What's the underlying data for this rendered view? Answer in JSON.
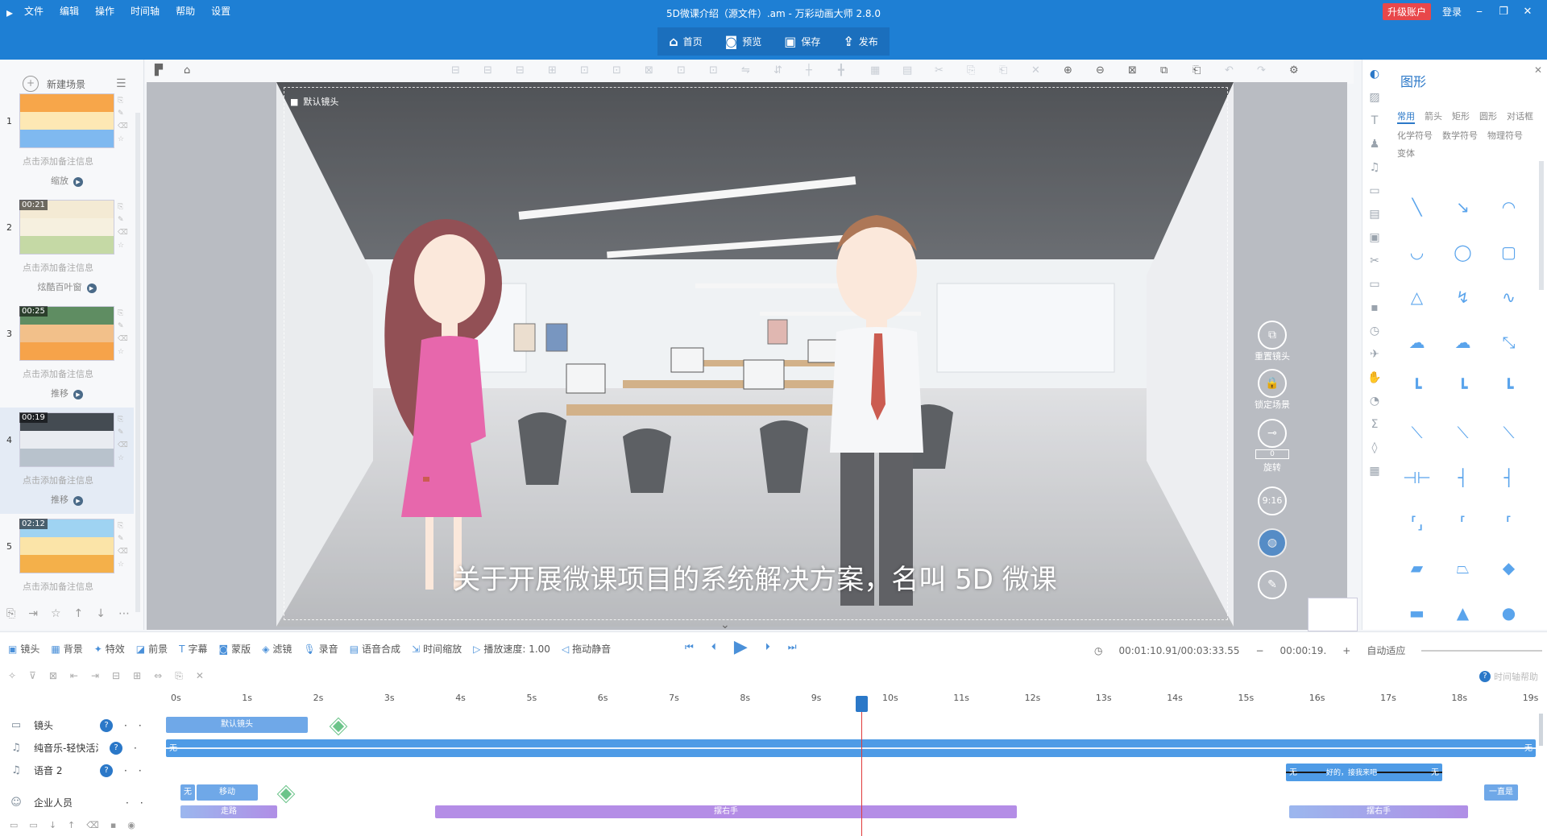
{
  "app": {
    "logo_text": "▸",
    "window_title": "5D微课介绍（源文件）.am - 万彩动画大师 2.8.0",
    "menu": [
      "文件",
      "编辑",
      "操作",
      "时间轴",
      "帮助",
      "设置"
    ],
    "upgrade_label": "升级账户",
    "login_label": "登录",
    "win_controls": [
      "⎯",
      "❐",
      "✕"
    ]
  },
  "main_toolbar": [
    {
      "icon": "home-icon",
      "glyph": "⌂",
      "label": "首页"
    },
    {
      "icon": "preview-icon",
      "glyph": "◙",
      "label": "预览"
    },
    {
      "icon": "save-icon",
      "glyph": "▣",
      "label": "保存"
    },
    {
      "icon": "publish-icon",
      "glyph": "⇪",
      "label": "发布"
    }
  ],
  "scene_panel": {
    "new_scene_label": "新建场景",
    "scenes": [
      {
        "num": "1",
        "duration": "",
        "note": "点击添加备注信息",
        "transition": "缩放",
        "thumb_colors": [
          "#f7a64a",
          "#fde8b4",
          "#7fb9f0"
        ]
      },
      {
        "num": "2",
        "duration": "00:21",
        "note": "点击添加备注信息",
        "transition": "炫酷百叶窗",
        "thumb_colors": [
          "#f4ead4",
          "#f6f0df",
          "#c5d9a5"
        ]
      },
      {
        "num": "3",
        "duration": "00:25",
        "note": "点击添加备注信息",
        "transition": "推移",
        "thumb_colors": [
          "#5f8d62",
          "#f2c08a",
          "#f6a34a"
        ]
      },
      {
        "num": "4",
        "duration": "00:19",
        "note": "点击添加备注信息",
        "transition": "推移",
        "thumb_colors": [
          "#444b52",
          "#e9ecf1",
          "#b8c2cc"
        ]
      },
      {
        "num": "5",
        "duration": "02:12",
        "note": "点击添加备注信息",
        "transition": "",
        "thumb_colors": [
          "#9fd3f2",
          "#fbe4a8",
          "#f4b04a"
        ]
      }
    ]
  },
  "stage": {
    "camera_label": "默认镜头",
    "subtitle": "关于开展微课项目的系统解决方案，名叫 5D 微课",
    "controls": [
      {
        "name": "reset-camera",
        "glyph": "⧉",
        "label": "重置镜头"
      },
      {
        "name": "lock-scene",
        "glyph": "🔒",
        "label": "锁定场景"
      },
      {
        "name": "rotate",
        "glyph": "⊸",
        "label": "旋转"
      },
      {
        "name": "ratio",
        "glyph": "9:16",
        "label": ""
      },
      {
        "name": "mask",
        "glyph": "◍",
        "label": ""
      },
      {
        "name": "pen",
        "glyph": "✎",
        "label": ""
      }
    ],
    "rotate_value": "0"
  },
  "shape_panel": {
    "title": "图形",
    "close": "✕",
    "tabs": [
      "常用",
      "箭头",
      "矩形",
      "圆形",
      "对话框",
      "化学符号",
      "数学符号",
      "物理符号",
      "变体"
    ],
    "selected_tab": "常用",
    "shapes": [
      "╲",
      "↘",
      "◠",
      "◡",
      "◯",
      "▢",
      "△",
      "↯",
      "∿",
      "☁",
      "☁",
      "⤡",
      "┗",
      "┗",
      "┗",
      "⟍",
      "⟍",
      "⟍",
      "⊣⊢",
      "┤",
      "┤",
      "⸢⸥",
      "⸢",
      "⸢",
      "▰",
      "⏢",
      "◆",
      "▬",
      "▲",
      "●",
      "◓",
      "◣",
      "◓"
    ]
  },
  "timeline_tools": [
    {
      "icon": "camera-icon",
      "glyph": "▣",
      "label": "镜头"
    },
    {
      "icon": "background-icon",
      "glyph": "▦",
      "label": "背景"
    },
    {
      "icon": "effect-icon",
      "glyph": "✦",
      "label": "特效"
    },
    {
      "icon": "foreground-icon",
      "glyph": "◪",
      "label": "前景"
    },
    {
      "icon": "caption-icon",
      "glyph": "T",
      "label": "字幕"
    },
    {
      "icon": "mask-icon",
      "glyph": "◙",
      "label": "蒙版"
    },
    {
      "icon": "filter-icon",
      "glyph": "◈",
      "label": "滤镜"
    },
    {
      "icon": "record-icon",
      "glyph": "🎙",
      "label": "录音"
    },
    {
      "icon": "tts-icon",
      "glyph": "▤",
      "label": "语音合成"
    },
    {
      "icon": "scale-icon",
      "glyph": "⇲",
      "label": "时间缩放"
    },
    {
      "icon": "speed-icon",
      "glyph": "▷",
      "label": "播放速度: 1.00"
    },
    {
      "icon": "mute-icon",
      "glyph": "◁",
      "label": "拖动静音"
    }
  ],
  "playback": {
    "time_current_total": "00:01:10.91/00:03:33.55",
    "zoom_time": "00:00:19.",
    "auto_fit_label": "自动适应"
  },
  "timeline": {
    "help_label": "时间轴帮助",
    "ticks": [
      "0s",
      "1s",
      "2s",
      "3s",
      "4s",
      "5s",
      "6s",
      "7s",
      "8s",
      "9s",
      "10s",
      "11s",
      "12s",
      "13s",
      "14s",
      "15s",
      "16s",
      "17s",
      "18s",
      "19s"
    ],
    "tracks": [
      {
        "name": "镜头",
        "icon": "camera-icon",
        "glyph": "▭"
      },
      {
        "name": "纯音乐-轻快活泼",
        "icon": "music-icon",
        "glyph": "♫"
      },
      {
        "name": "语音 2",
        "icon": "voice-icon",
        "glyph": "♫"
      },
      {
        "name": "企业人员",
        "icon": "person-icon",
        "glyph": "☺"
      }
    ],
    "clips": {
      "camera": "默认镜头",
      "music_start": "无",
      "music_end": "无",
      "voice_start": "无",
      "voice_text": "好的，接我来吧",
      "voice_end": "无",
      "person_enter_none": "无",
      "person_enter": "移动",
      "person_walk": "走路",
      "person_wave": "摆右手",
      "person_wave2": "摆右手",
      "person_still": "一直是"
    }
  }
}
